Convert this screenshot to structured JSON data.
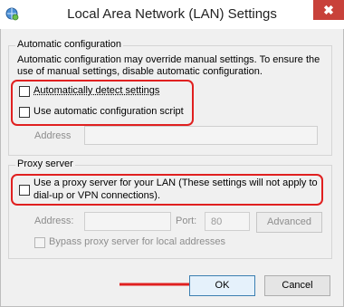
{
  "window": {
    "title": "Local Area Network (LAN) Settings",
    "close_glyph": "✖"
  },
  "auto": {
    "legend": "Automatic configuration",
    "desc_line1": "Automatic configuration may override manual settings.  To ensure the",
    "desc_line2": "use of manual settings, disable automatic configuration.",
    "detect_label": "Automatically detect settings",
    "script_label": "Use automatic configuration script",
    "address_label": "Address",
    "address_value": ""
  },
  "proxy": {
    "legend": "Proxy server",
    "use_line1": "Use a proxy server for your LAN (These settings will not apply to",
    "use_line2": "dial-up or VPN connections).",
    "address_label": "Address:",
    "address_value": "",
    "port_label": "Port:",
    "port_value": "80",
    "advanced_label": "Advanced",
    "bypass_label": "Bypass proxy server for local addresses"
  },
  "buttons": {
    "ok": "OK",
    "cancel": "Cancel"
  },
  "colors": {
    "highlight": "#e02020",
    "close_bg": "#c8413a"
  },
  "icons": {
    "app": "network-settings-icon",
    "close": "close-icon",
    "arrow": "red-arrow-icon"
  }
}
